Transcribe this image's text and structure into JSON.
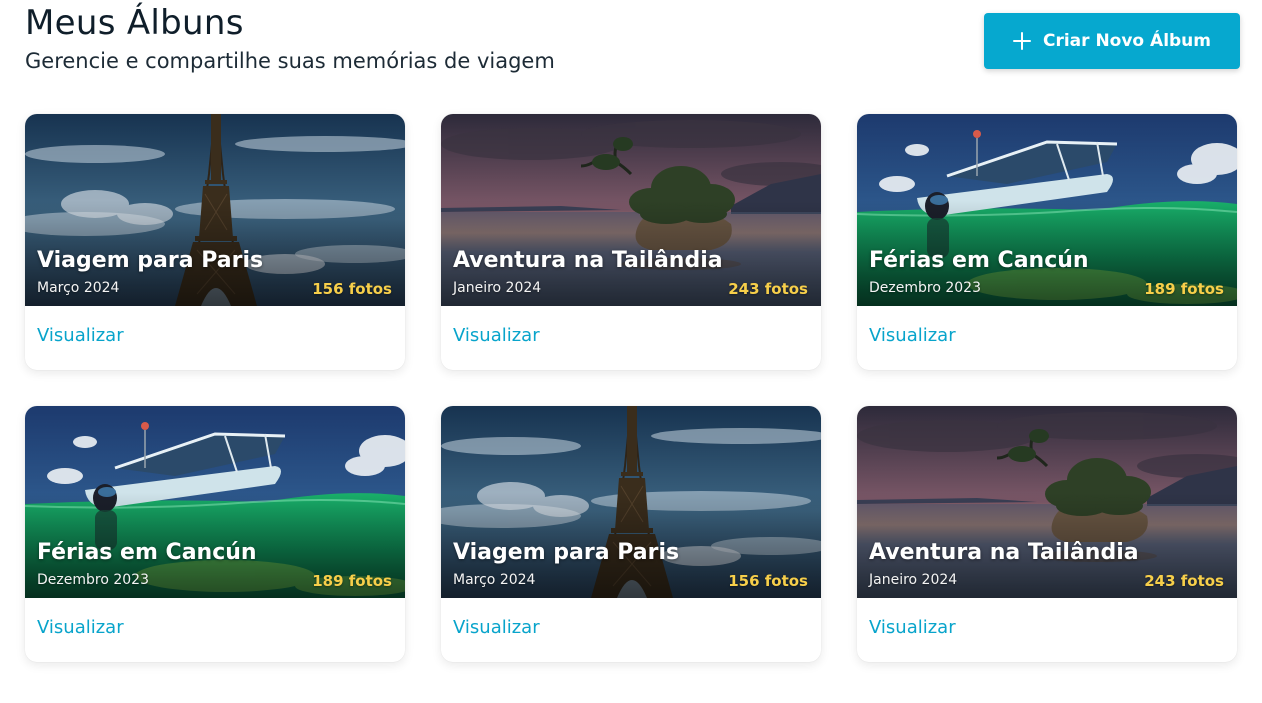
{
  "header": {
    "title": "Meus Álbuns",
    "subtitle": "Gerencie e compartilhe suas memórias de viagem",
    "create_button_label": "Criar Novo Álbum",
    "create_button_icon": "plus-icon"
  },
  "colors": {
    "accent": "#06a8cf",
    "photo_count": "#f7cf4a",
    "link": "#08a4cb"
  },
  "albums": [
    {
      "title": "Viagem para Paris",
      "date": "Março 2024",
      "count": "156 fotos",
      "link": "Visualizar",
      "image": "eiffel-tower"
    },
    {
      "title": "Aventura na Tailândia",
      "date": "Janeiro 2024",
      "count": "243 fotos",
      "link": "Visualizar",
      "image": "island-sunset"
    },
    {
      "title": "Férias em Cancún",
      "date": "Dezembro 2023",
      "count": "189 fotos",
      "link": "Visualizar",
      "image": "boat-snorkel"
    },
    {
      "title": "Férias em Cancún",
      "date": "Dezembro 2023",
      "count": "189 fotos",
      "link": "Visualizar",
      "image": "boat-snorkel"
    },
    {
      "title": "Viagem para Paris",
      "date": "Março 2024",
      "count": "156 fotos",
      "link": "Visualizar",
      "image": "eiffel-tower"
    },
    {
      "title": "Aventura na Tailândia",
      "date": "Janeiro 2024",
      "count": "243 fotos",
      "link": "Visualizar",
      "image": "island-sunset"
    }
  ]
}
